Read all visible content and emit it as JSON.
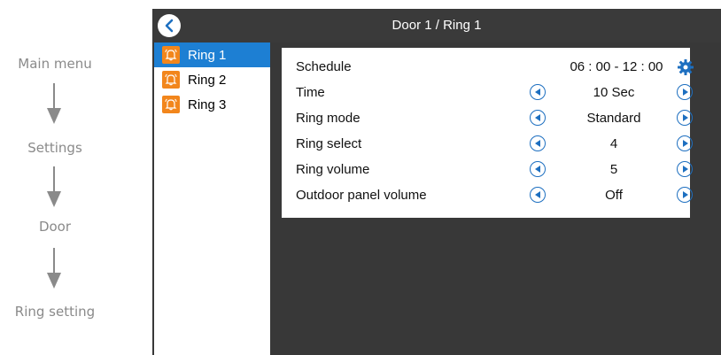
{
  "flow": {
    "steps": [
      "Main menu",
      "Settings",
      "Door",
      "Ring setting"
    ]
  },
  "header": {
    "title": "Door 1 / Ring 1",
    "back_icon": "back-arrow-icon"
  },
  "sidebar": {
    "items": [
      {
        "label": "Ring 1",
        "icon": "bell-icon",
        "selected": true
      },
      {
        "label": "Ring 2",
        "icon": "bell-icon",
        "selected": false
      },
      {
        "label": "Ring 3",
        "icon": "bell-icon",
        "selected": false
      }
    ]
  },
  "settings": {
    "schedule": {
      "label": "Schedule",
      "value": "06 : 00 - 12 : 00",
      "icon": "gear-icon"
    },
    "rows": [
      {
        "label": "Time",
        "value": "10 Sec"
      },
      {
        "label": "Ring mode",
        "value": "Standard"
      },
      {
        "label": "Ring select",
        "value": "4"
      },
      {
        "label": "Ring volume",
        "value": "5"
      },
      {
        "label": "Outdoor panel volume",
        "value": "Off"
      }
    ]
  },
  "colors": {
    "accent": "#1d7fd3",
    "bell": "#f2861c",
    "screen_bg": "#383838",
    "flow_gray": "#8a8a8a"
  }
}
